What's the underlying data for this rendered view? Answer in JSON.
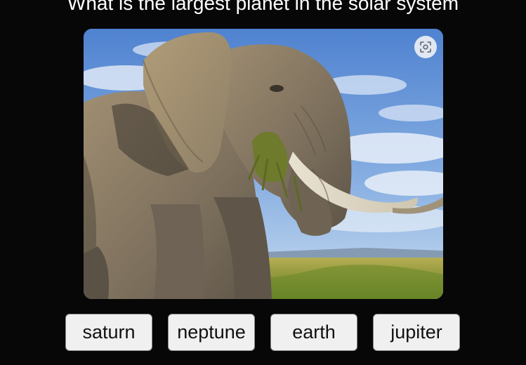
{
  "question": {
    "text": "What is the largest planet in the solar system"
  },
  "image": {
    "subject": "elephant",
    "lens_icon": "visual-search-icon"
  },
  "answers": [
    {
      "label": "saturn"
    },
    {
      "label": "neptune"
    },
    {
      "label": "earth"
    },
    {
      "label": "jupiter"
    }
  ],
  "colors": {
    "background": "#070707",
    "question_text": "#ffffff",
    "button_background": "#f0f0f0",
    "button_text": "#111111",
    "sky": "#6a9ad6",
    "grass": "#8a8f3a",
    "elephant": "#8a7c68"
  }
}
